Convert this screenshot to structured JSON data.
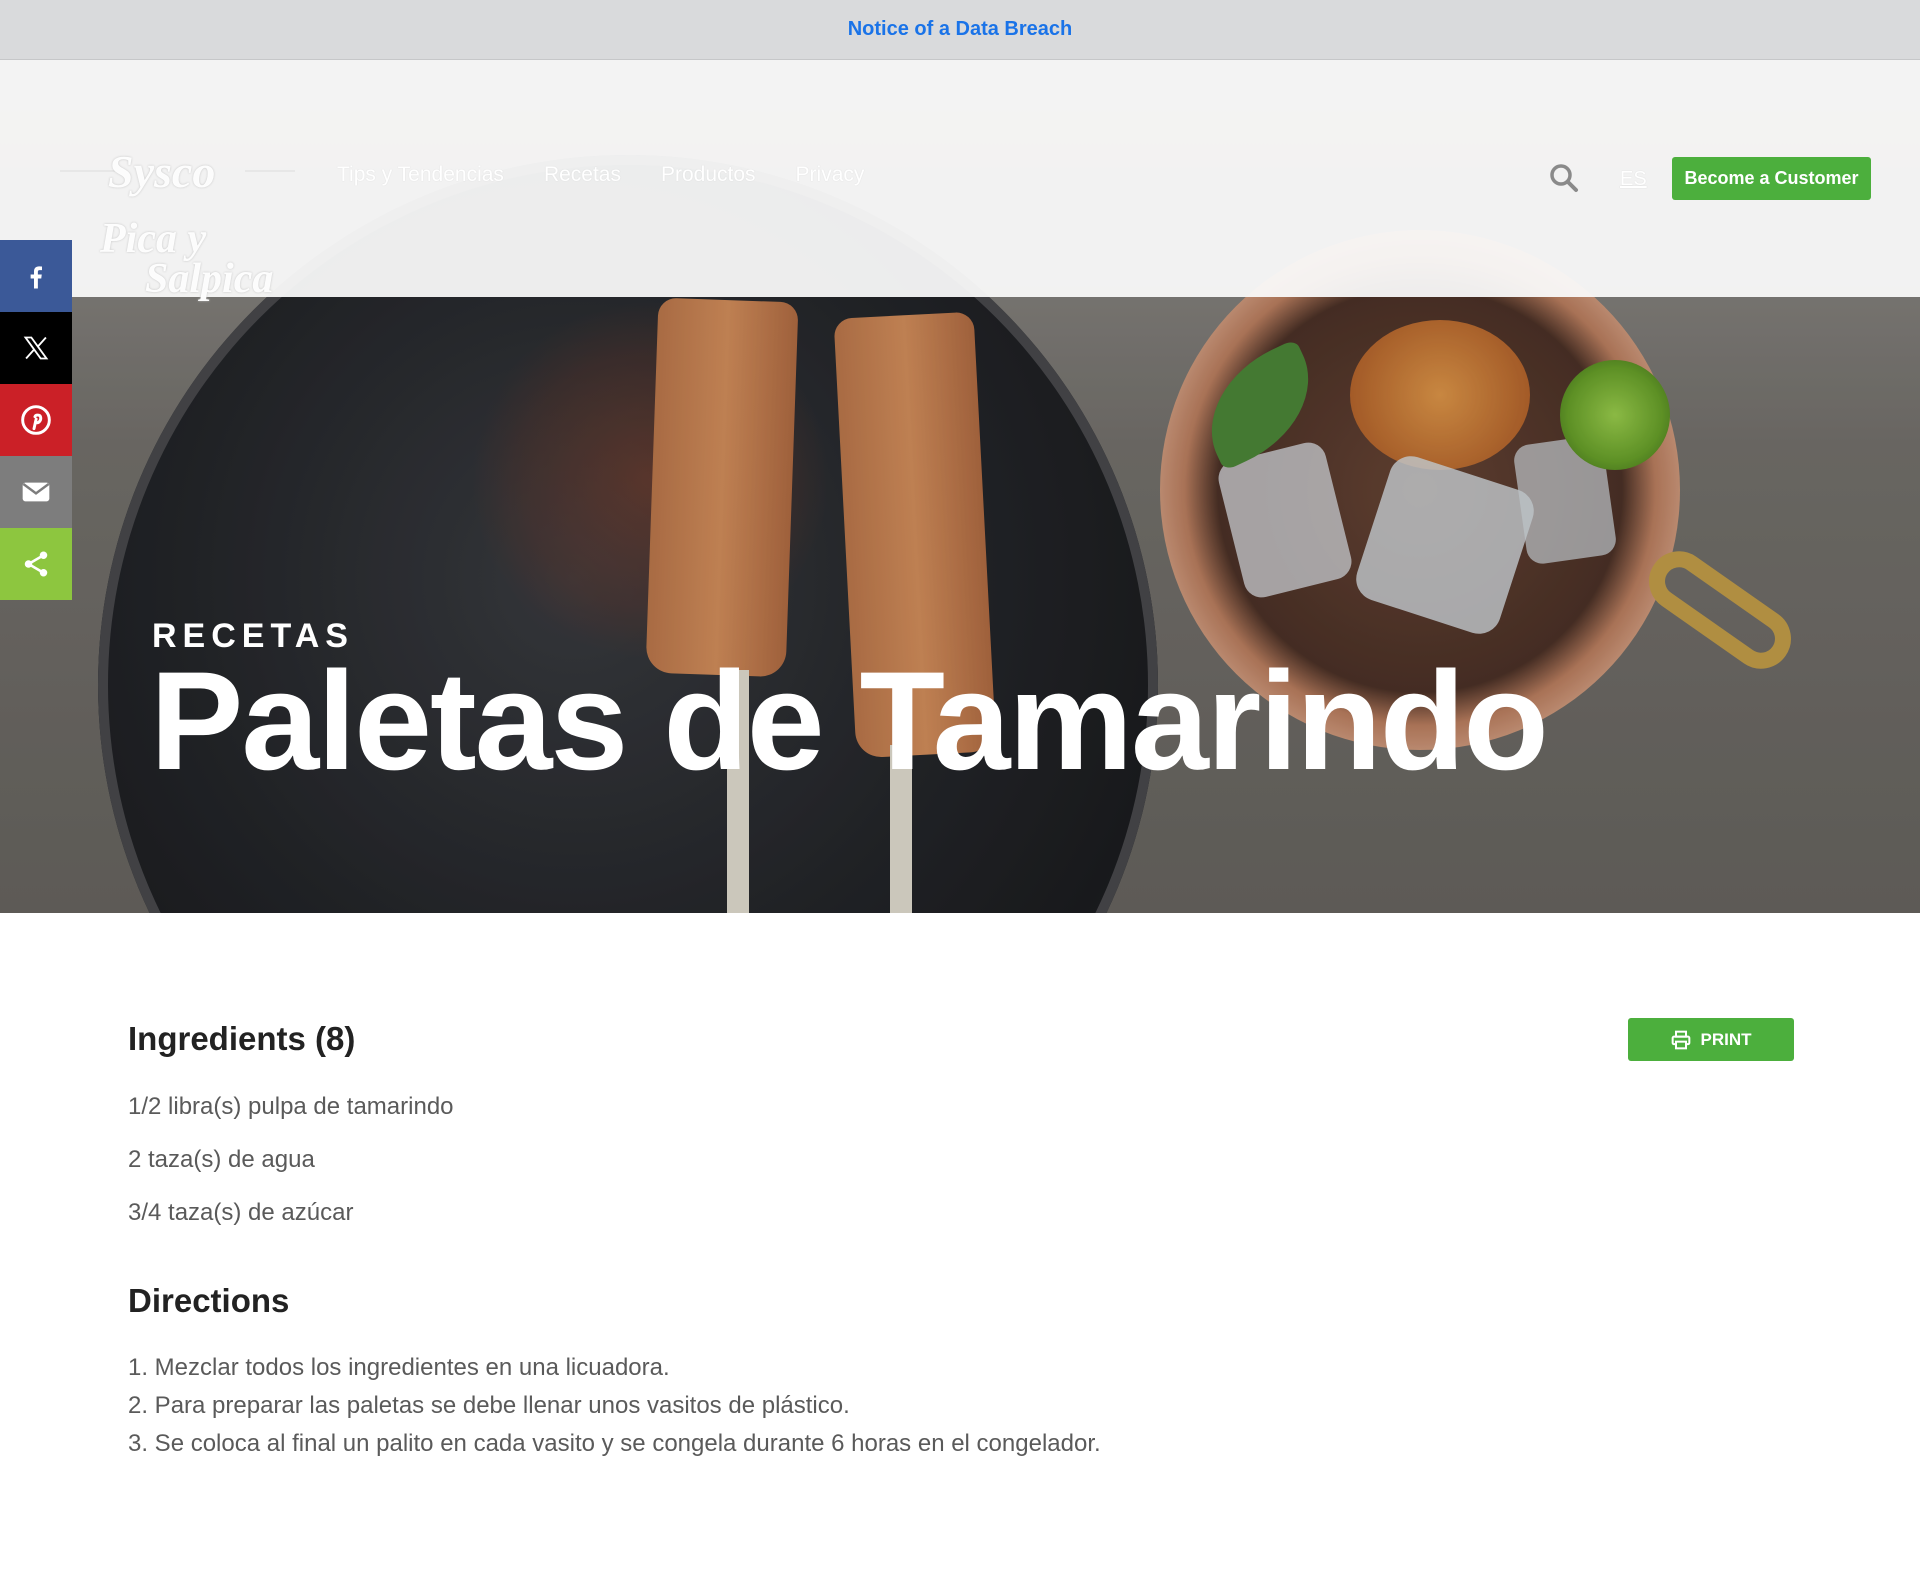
{
  "notice": {
    "text": "Notice of a Data Breach"
  },
  "header": {
    "logo_text": {
      "line1": "Sysco",
      "line2": "Pica y",
      "line3": "Salpica"
    },
    "nav": [
      {
        "label": "Tips y Tendencias"
      },
      {
        "label": "Recetas"
      },
      {
        "label": "Productos"
      },
      {
        "label": "Privacy"
      }
    ],
    "search_icon": "search-icon",
    "language": "ES",
    "cta_label": "Become a Customer"
  },
  "share": {
    "items": [
      {
        "icon": "facebook-icon",
        "color": "#3b5998"
      },
      {
        "icon": "x-icon",
        "color": "#000000"
      },
      {
        "icon": "pinterest-icon",
        "color": "#cb2027"
      },
      {
        "icon": "email-icon",
        "color": "#7d7d7d"
      },
      {
        "icon": "share-icon",
        "color": "#8dc63f"
      }
    ]
  },
  "hero": {
    "category": "RECETAS",
    "title": "Paletas de Tamarindo"
  },
  "recipe": {
    "ingredients_title": "Ingredients (8)",
    "print_label": "PRINT",
    "ingredients": [
      "1/2 libra(s) pulpa de tamarindo",
      "2 taza(s) de agua",
      "3/4 taza(s) de azúcar"
    ],
    "directions_title": "Directions",
    "directions": [
      "1. Mezclar todos los ingredientes en una licuadora.",
      "2. Para preparar las paletas se debe llenar unos vasitos de plástico.",
      "3. Se coloca al final un palito en cada vasito y se congela durante 6 horas en el congelador."
    ]
  },
  "colors": {
    "accent_green": "#4caf3d",
    "notice_link": "#1a73e8",
    "notice_bg": "#d9dadc"
  }
}
